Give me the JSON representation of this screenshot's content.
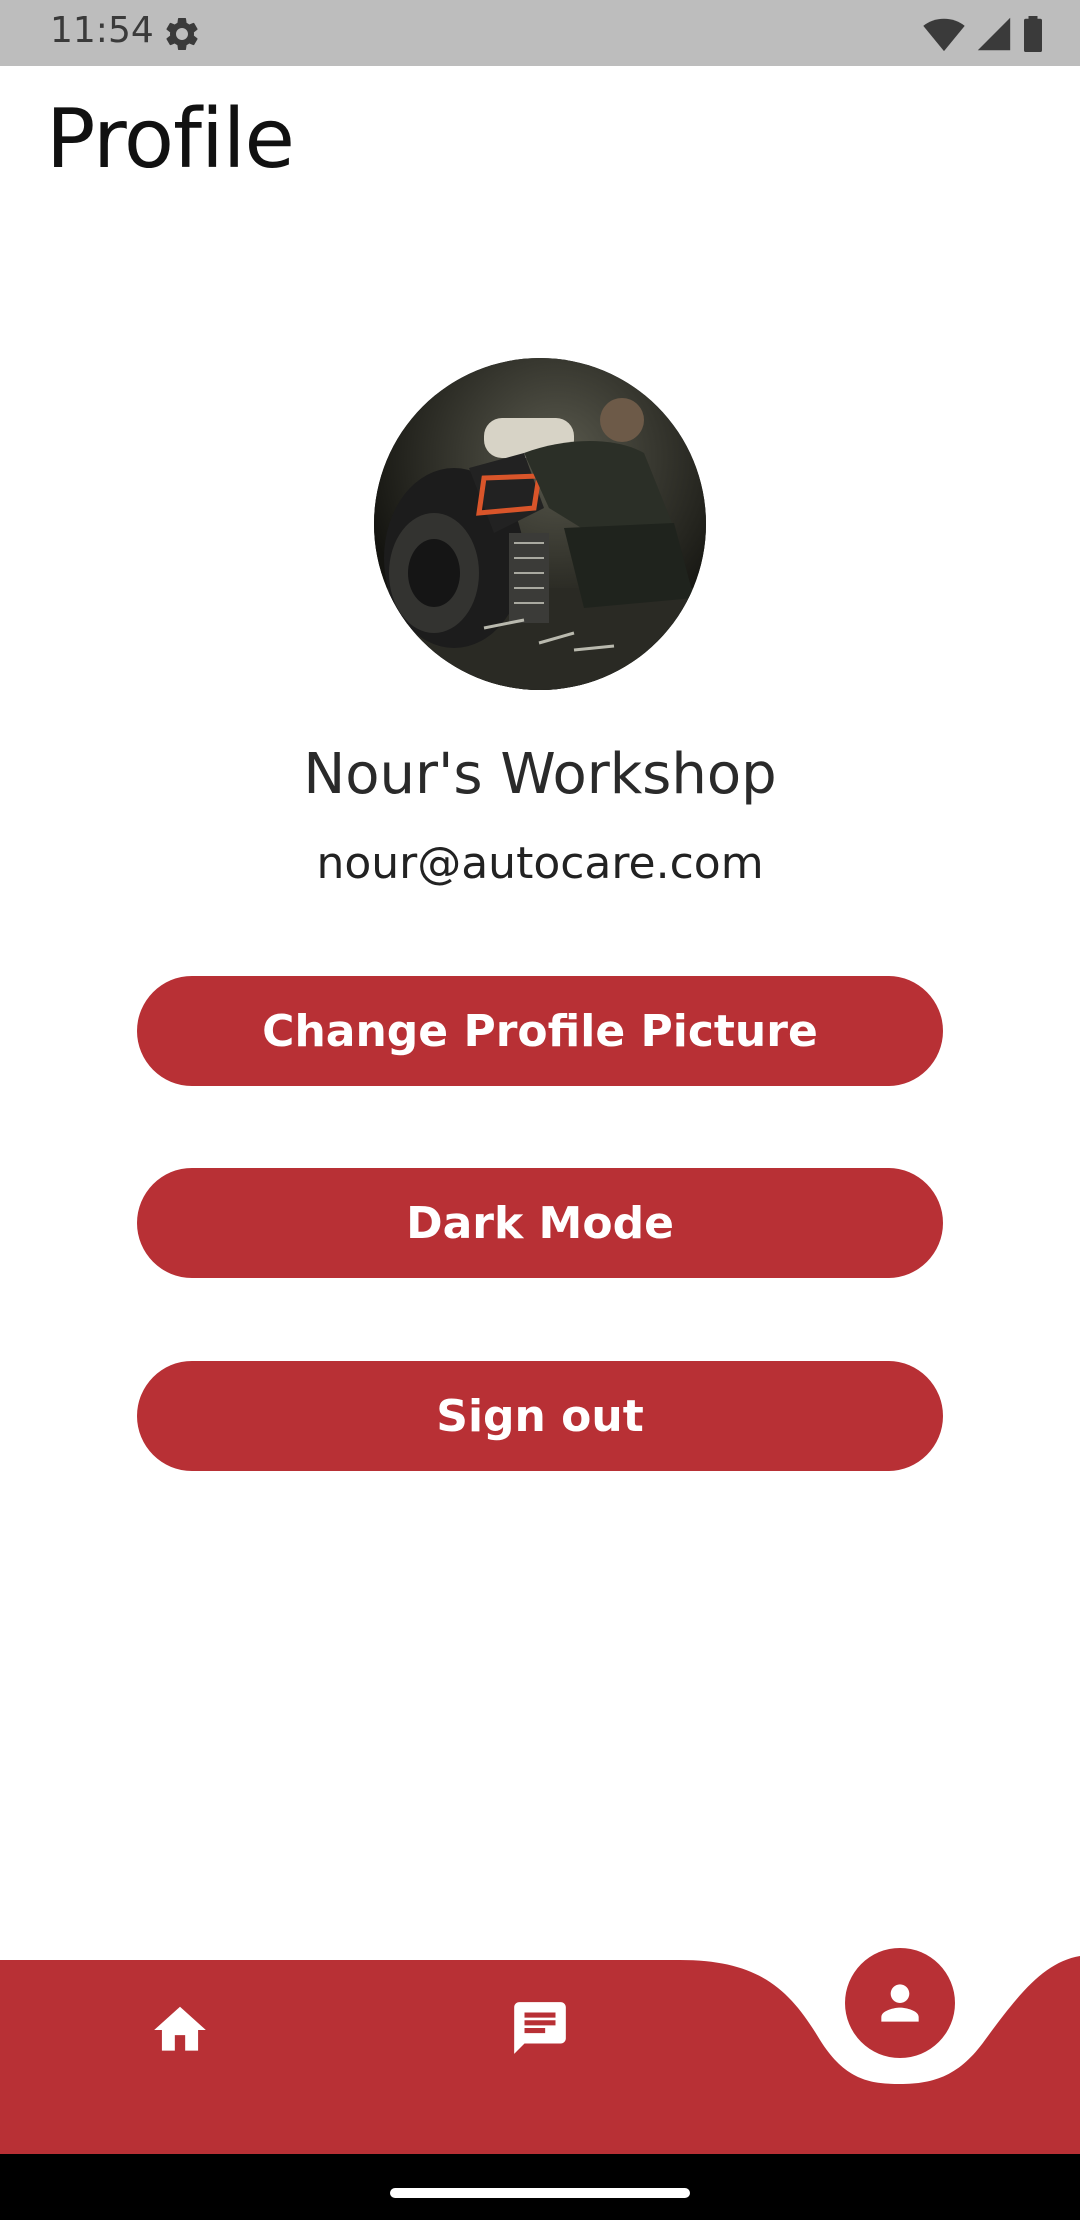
{
  "status_bar": {
    "time": "11:54",
    "icons": [
      "settings-gear-icon",
      "wifi-icon",
      "cellular-signal-icon",
      "battery-icon"
    ]
  },
  "header": {
    "title": "Profile"
  },
  "profile": {
    "avatar": "workshop-mechanic-photo",
    "name": "Nour's Workshop",
    "email": "nour@autocare.com"
  },
  "actions": {
    "change_picture_label": "Change Profile Picture",
    "dark_mode_label": "Dark Mode",
    "sign_out_label": "Sign out"
  },
  "bottom_nav": {
    "items": [
      {
        "icon": "home-icon",
        "active": false
      },
      {
        "icon": "message-icon",
        "active": false
      },
      {
        "icon": "person-icon",
        "active": true
      }
    ]
  },
  "colors": {
    "accent": "#b83035",
    "background": "#ffffff",
    "status_bar": "#bdbdbd"
  }
}
